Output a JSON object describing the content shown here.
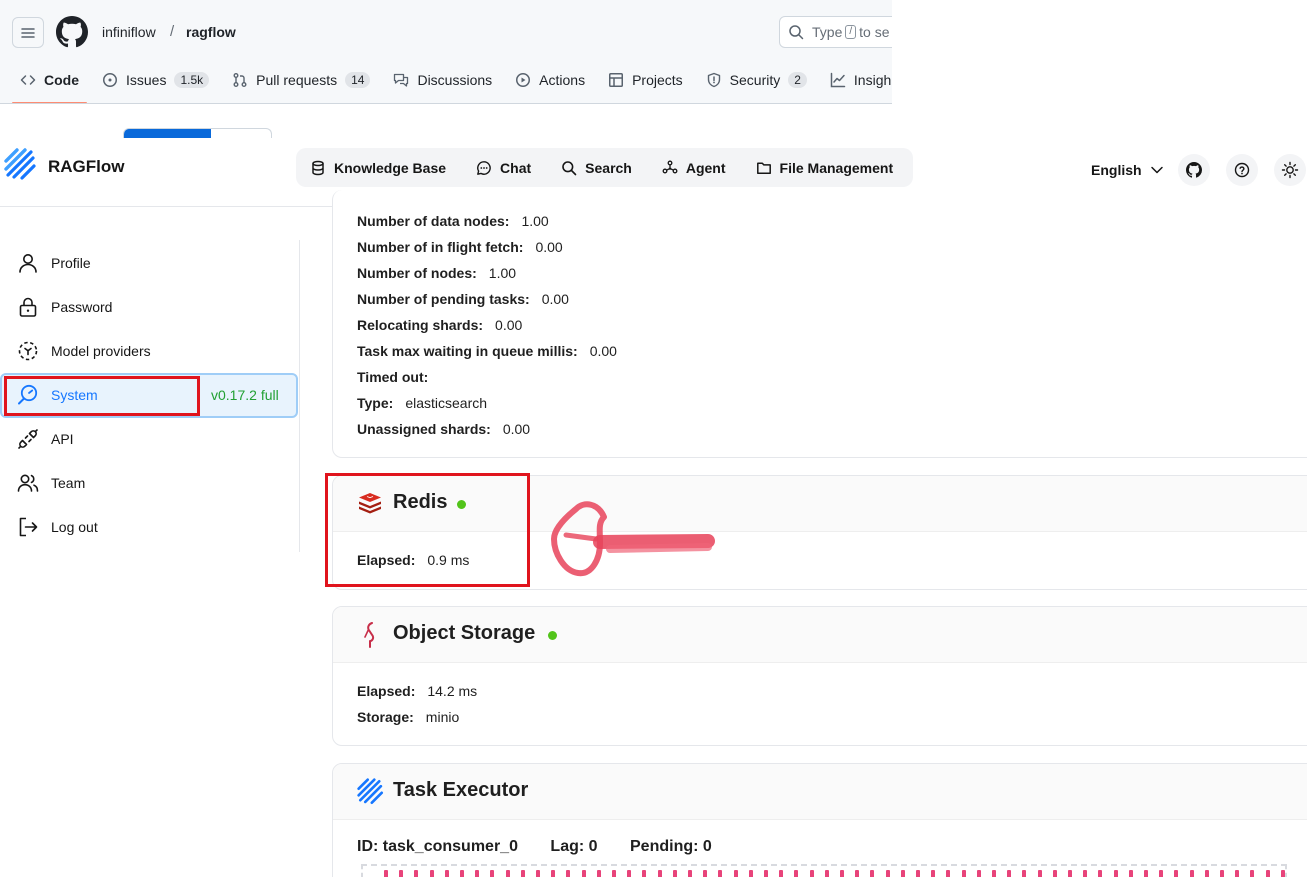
{
  "github": {
    "owner": "infiniflow",
    "separator": "/",
    "repo": "ragflow",
    "search_prefix": "Type",
    "search_key": "/",
    "search_suffix": "to se",
    "tabs": [
      {
        "label": "Code",
        "icon": "code-icon",
        "count": ""
      },
      {
        "label": "Issues",
        "icon": "issue-icon",
        "count": "1.5k"
      },
      {
        "label": "Pull requests",
        "icon": "pull-request-icon",
        "count": "14"
      },
      {
        "label": "Discussions",
        "icon": "discussion-icon",
        "count": ""
      },
      {
        "label": "Actions",
        "icon": "play-icon",
        "count": ""
      },
      {
        "label": "Projects",
        "icon": "table-icon",
        "count": ""
      },
      {
        "label": "Security",
        "icon": "shield-icon",
        "count": "2"
      },
      {
        "label": "Insigh",
        "icon": "graph-icon",
        "count": ""
      }
    ]
  },
  "app": {
    "name": "RAGFlow",
    "nav": [
      {
        "label": "Knowledge Base",
        "icon": "database-icon"
      },
      {
        "label": "Chat",
        "icon": "chat-icon"
      },
      {
        "label": "Search",
        "icon": "search-icon"
      },
      {
        "label": "Agent",
        "icon": "agent-icon"
      },
      {
        "label": "File Management",
        "icon": "folder-icon"
      }
    ],
    "language": "English"
  },
  "sidebar": {
    "items": [
      {
        "label": "Profile",
        "icon": "user-icon"
      },
      {
        "label": "Password",
        "icon": "lock-icon"
      },
      {
        "label": "Model providers",
        "icon": "model-icon"
      },
      {
        "label": "System",
        "icon": "system-icon"
      },
      {
        "label": "API",
        "icon": "api-icon"
      },
      {
        "label": "Team",
        "icon": "team-icon"
      },
      {
        "label": "Log out",
        "icon": "logout-icon"
      }
    ],
    "version": "v0.17.2 full",
    "active": "System"
  },
  "elasticsearch": {
    "rows": [
      {
        "key": "Number of data nodes:",
        "value": "1.00"
      },
      {
        "key": "Number of in flight fetch:",
        "value": "0.00"
      },
      {
        "key": "Number of nodes:",
        "value": "1.00"
      },
      {
        "key": "Number of pending tasks:",
        "value": "0.00"
      },
      {
        "key": "Relocating shards:",
        "value": "0.00"
      },
      {
        "key": "Task max waiting in queue millis:",
        "value": "0.00"
      },
      {
        "key": "Timed out:",
        "value": ""
      },
      {
        "key": "Type:",
        "value": "elasticsearch"
      },
      {
        "key": "Unassigned shards:",
        "value": "0.00"
      }
    ]
  },
  "redis": {
    "title": "Redis",
    "status_color": "#52c41a",
    "elapsed_key": "Elapsed:",
    "elapsed_value": "0.9 ms"
  },
  "object_storage": {
    "title": "Object Storage",
    "status_color": "#52c41a",
    "elapsed_key": "Elapsed:",
    "elapsed_value": "14.2 ms",
    "storage_key": "Storage:",
    "storage_value": "minio"
  },
  "task_executor": {
    "title": "Task Executor",
    "id": "ID: task_consumer_0",
    "lag": "Lag: 0",
    "pending": "Pending: 0"
  },
  "colors": {
    "highlight_red": "#e0141d",
    "status_green": "#52c41a",
    "version_green": "#22a033",
    "active_blue": "#1677ff"
  }
}
